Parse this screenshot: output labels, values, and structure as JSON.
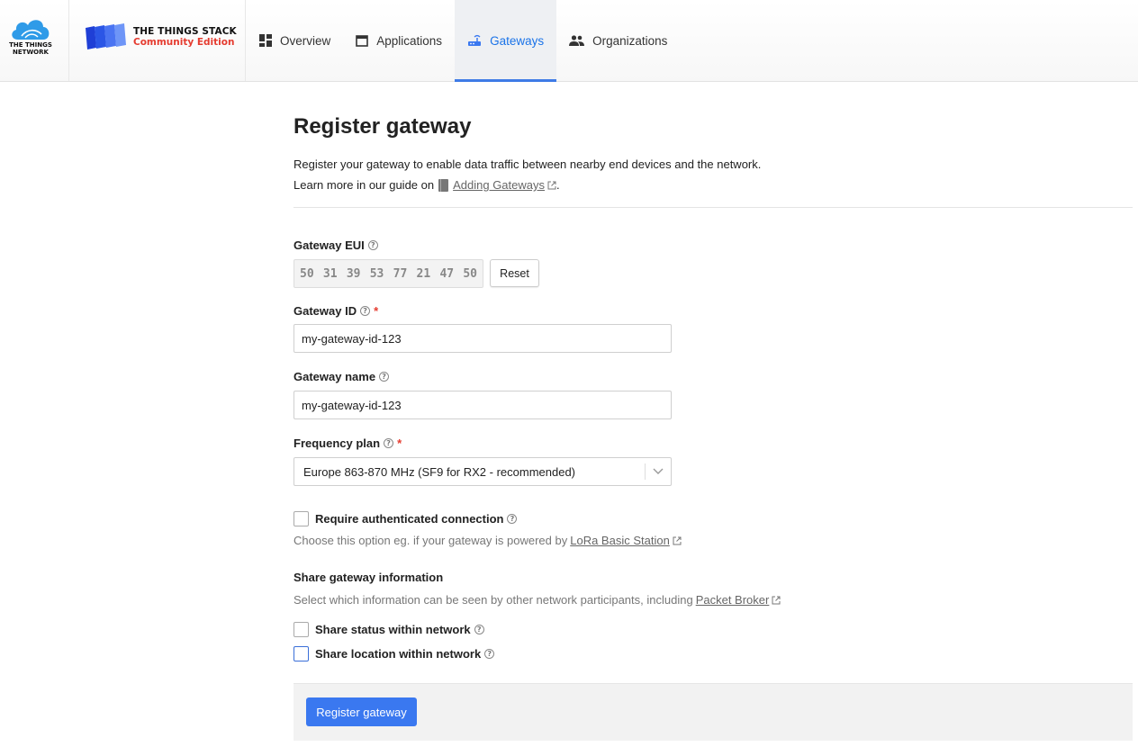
{
  "brand": {
    "network_name_line1": "THE THINGS",
    "network_name_line2": "NETWORK",
    "product_title": "THE THINGS STACK",
    "product_edition": "Community Edition",
    "accent_color": "#3a78f0",
    "edition_color": "#e53b2f"
  },
  "nav": {
    "items": [
      {
        "label": "Overview",
        "icon": "dashboard-icon",
        "active": false
      },
      {
        "label": "Applications",
        "icon": "window-icon",
        "active": false
      },
      {
        "label": "Gateways",
        "icon": "router-icon",
        "active": true
      },
      {
        "label": "Organizations",
        "icon": "people-icon",
        "active": false
      }
    ]
  },
  "page": {
    "title": "Register gateway",
    "description": "Register your gateway to enable data traffic between nearby end devices and the network.",
    "guide_prefix": "Learn more in our guide on",
    "guide_link": "Adding Gateways",
    "guide_suffix": "."
  },
  "form": {
    "gateway_eui": {
      "label": "Gateway EUI",
      "bytes": [
        "50",
        "31",
        "39",
        "53",
        "77",
        "21",
        "47",
        "50"
      ],
      "reset_label": "Reset"
    },
    "gateway_id": {
      "label": "Gateway ID",
      "required_mark": "*",
      "value": "my-gateway-id-123"
    },
    "gateway_name": {
      "label": "Gateway name",
      "value": "my-gateway-id-123"
    },
    "frequency_plan": {
      "label": "Frequency plan",
      "required_mark": "*",
      "value": "Europe 863-870 MHz (SF9 for RX2 - recommended)"
    },
    "require_auth": {
      "label": "Require authenticated connection",
      "checked": false,
      "hint_prefix": "Choose this option eg. if your gateway is powered by",
      "hint_link": "LoRa Basic Station"
    },
    "share": {
      "title": "Share gateway information",
      "hint_prefix": "Select which information can be seen by other network participants, including",
      "hint_link": "Packet Broker",
      "status_label": "Share status within network",
      "location_label": "Share location within network"
    },
    "submit_label": "Register gateway",
    "help_glyph": "?"
  }
}
